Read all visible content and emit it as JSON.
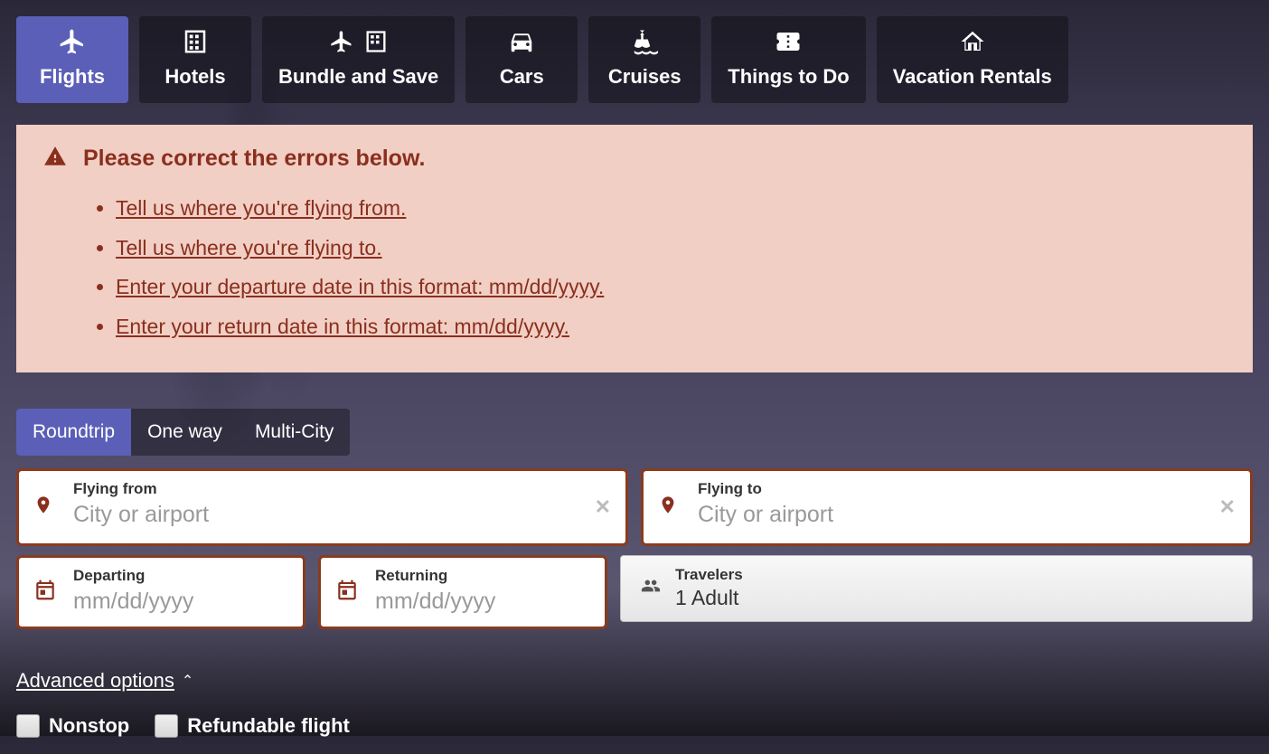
{
  "nav": {
    "tabs": [
      {
        "key": "flights",
        "label": "Flights",
        "active": true
      },
      {
        "key": "hotels",
        "label": "Hotels",
        "active": false
      },
      {
        "key": "bundle",
        "label": "Bundle and Save",
        "active": false
      },
      {
        "key": "cars",
        "label": "Cars",
        "active": false
      },
      {
        "key": "cruises",
        "label": "Cruises",
        "active": false
      },
      {
        "key": "things",
        "label": "Things to Do",
        "active": false
      },
      {
        "key": "vacation",
        "label": "Vacation Rentals",
        "active": false
      }
    ]
  },
  "error": {
    "title": "Please correct the errors below.",
    "items": [
      "Tell us where you're flying from.",
      "Tell us where you're flying to.",
      "Enter your departure date in this format: mm/dd/yyyy.",
      "Enter your return date in this format: mm/dd/yyyy."
    ]
  },
  "trip_types": {
    "options": [
      {
        "key": "roundtrip",
        "label": "Roundtrip",
        "active": true
      },
      {
        "key": "oneway",
        "label": "One way",
        "active": false
      },
      {
        "key": "multi",
        "label": "Multi-City",
        "active": false
      }
    ]
  },
  "fields": {
    "from": {
      "label": "Flying from",
      "placeholder": "City or airport",
      "value": ""
    },
    "to": {
      "label": "Flying to",
      "placeholder": "City or airport",
      "value": ""
    },
    "departing": {
      "label": "Departing",
      "placeholder": "mm/dd/yyyy",
      "value": ""
    },
    "returning": {
      "label": "Returning",
      "placeholder": "mm/dd/yyyy",
      "value": ""
    },
    "travelers": {
      "label": "Travelers",
      "value": "1 Adult"
    }
  },
  "advanced": {
    "label": "Advanced options"
  },
  "checks": {
    "nonstop": {
      "label": "Nonstop",
      "checked": false
    },
    "refundable": {
      "label": "Refundable flight",
      "checked": false
    }
  },
  "colors": {
    "primary": "#5b5fb7",
    "error": "#8a2f1e",
    "error_bg": "#f2cfc5"
  }
}
